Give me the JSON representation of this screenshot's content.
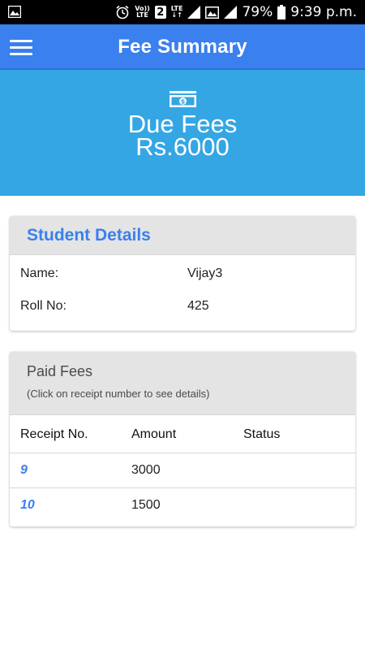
{
  "status_bar": {
    "left_icon": "image-icon",
    "volte_line1": "Vo))",
    "volte_line2": "LTE",
    "sim_slot": "2",
    "lte_line1": "LTE",
    "lte_line2": "↓↑",
    "battery": "79%",
    "time": "9:39 p.m."
  },
  "app_bar": {
    "menu_icon": "hamburger-menu-icon",
    "title": "Fee Summary"
  },
  "hero": {
    "icon": "money-bill-icon",
    "title": "Due Fees",
    "amount": "Rs.6000"
  },
  "student_details": {
    "title": "Student Details",
    "name_label": "Name:",
    "name_value": "Vijay3",
    "roll_label": "Roll No:",
    "roll_value": "425"
  },
  "paid_fees": {
    "title": "Paid Fees",
    "subtitle": "(Click on receipt number to see details)",
    "columns": [
      "Receipt No.",
      "Amount",
      "Status"
    ],
    "rows": [
      {
        "receipt": "9",
        "amount": "3000",
        "status": ""
      },
      {
        "receipt": "10",
        "amount": "1500",
        "status": ""
      }
    ]
  },
  "colors": {
    "app_bar": "#3a80ee",
    "hero": "#35a6e4",
    "accent": "#3a80ee",
    "card_header": "#e4e4e4"
  }
}
